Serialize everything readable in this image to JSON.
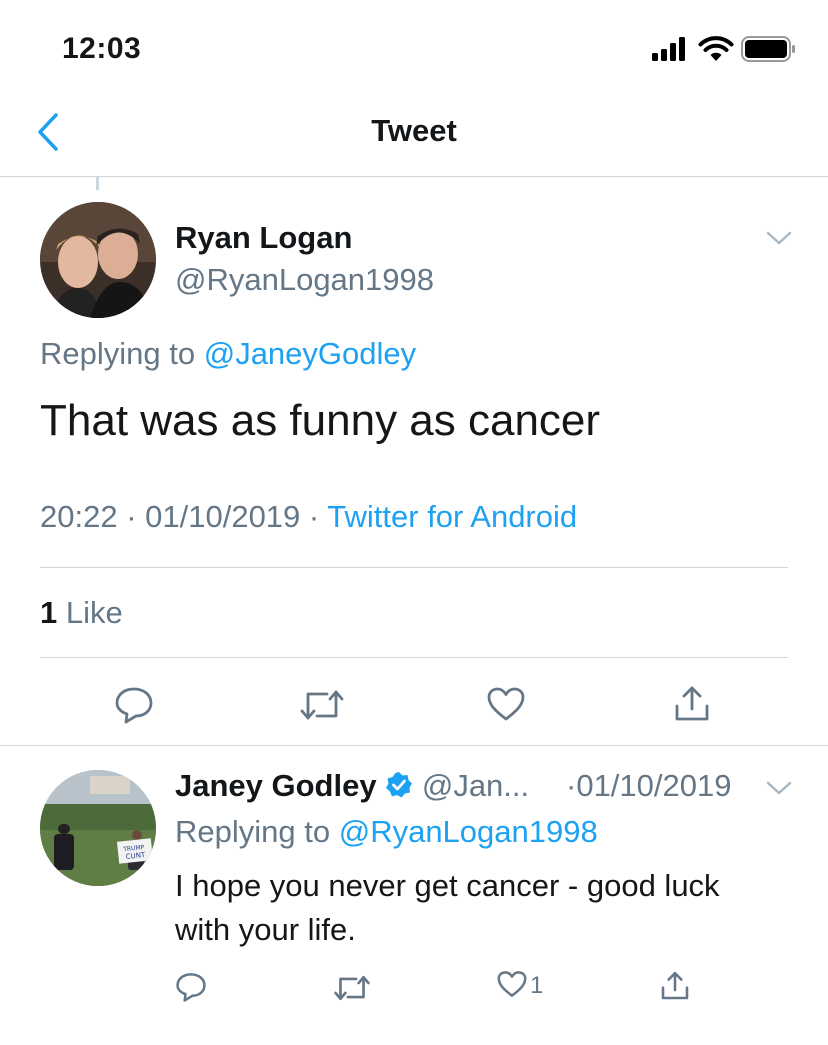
{
  "status_bar": {
    "time": "12:03"
  },
  "nav": {
    "title": "Tweet",
    "back_icon": "chevron-left-icon"
  },
  "main_tweet": {
    "author_name": "Ryan Logan",
    "author_handle": "@RyanLogan1998",
    "replying_prefix": "Replying to ",
    "replying_to": "@JaneyGodley",
    "text": "That was as funny as cancer",
    "time": "20:22",
    "date": "01/10/2019",
    "source": "Twitter for Android",
    "likes_count": "1",
    "likes_label": "Like"
  },
  "reply_tweet": {
    "author_name": "Janey Godley",
    "author_handle": "@Jan...",
    "date": "·01/10/2019",
    "replying_prefix": "Replying to ",
    "replying_to": "@RyanLogan1998",
    "text_line1": "I hope you never get cancer - good luck",
    "text_line2": "with your life.",
    "likes_count": "1",
    "sign_line1": "TRUMP",
    "sign_line2": "CUNT"
  },
  "colors": {
    "accent": "#1da1f2",
    "secondary_text": "#657786",
    "divider": "#ccd6dd",
    "verified": "#1da1f2"
  }
}
